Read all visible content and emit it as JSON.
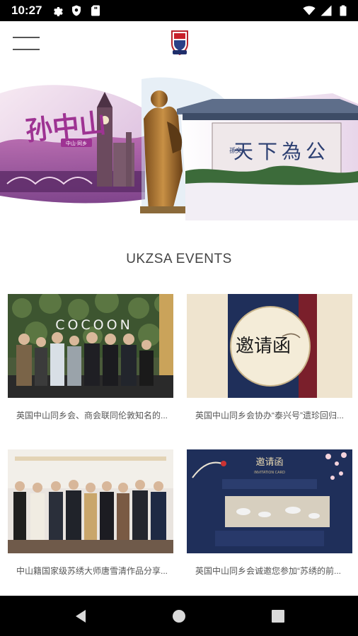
{
  "status_bar": {
    "time": "10:27",
    "icons_left": [
      "gear-icon",
      "shield-icon",
      "sd-card-icon"
    ],
    "icons_right": [
      "wifi-icon",
      "signal-icon",
      "battery-icon"
    ]
  },
  "app_bar": {
    "menu_icon": "hamburger-menu-icon",
    "logo": "ukzsa-logo"
  },
  "banner": {
    "calligraphy_left": "孙中山",
    "subtitle_left": "中山·同乡",
    "calligraphy_right": "天下為公",
    "signature": "孫文"
  },
  "section": {
    "title": "UKZSA EVENTS"
  },
  "events": [
    {
      "caption": "英国中山同乡会、商会联同伦敦知名的..."
    },
    {
      "caption": "英国中山同乡会协办“泰兴号”遗珍回归..."
    },
    {
      "caption": "中山籍国家级苏绣大师唐雪清作品分享..."
    },
    {
      "caption": "英国中山同乡会诚邀您参加“苏绣的前..."
    }
  ],
  "event_images": {
    "cocoon_sign": "COCOON",
    "invitation_text": "邀请函",
    "invitation2_title": "邀请函",
    "invitation2_subtitle": "INVITATION CARD"
  },
  "nav_bar": {
    "back": "back-icon",
    "home": "home-icon",
    "recents": "recents-icon"
  },
  "colors": {
    "status_bar": "#000000",
    "nav_bar": "#000000",
    "title_text": "#444444",
    "caption_text": "#555555",
    "banner_purple": "#8a3f8f",
    "navy": "#1f2f5a",
    "maroon": "#7a1f2b"
  }
}
